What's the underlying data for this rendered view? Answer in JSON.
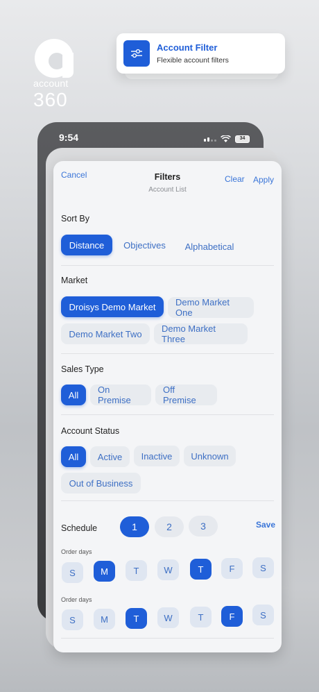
{
  "brand": {
    "word": "account",
    "number": "360"
  },
  "feature_card": {
    "title": "Account Filter",
    "subtitle": "Flexible account filters",
    "icon": "sliders-icon"
  },
  "status_bar": {
    "time": "9:54",
    "battery": "34"
  },
  "header": {
    "cancel": "Cancel",
    "title": "Filters",
    "subtitle": "Account List",
    "clear": "Clear",
    "apply": "Apply"
  },
  "sort_by": {
    "label": "Sort By",
    "options": [
      "Distance",
      "Objectives",
      "Alphabetical"
    ],
    "selected": "Distance"
  },
  "market": {
    "label": "Market",
    "options": [
      "Droisys Demo Market",
      "Demo Market One",
      "Demo Market Two",
      "Demo Market Three"
    ],
    "selected": "Droisys Demo Market"
  },
  "sales_type": {
    "label": "Sales Type",
    "options": [
      "All",
      "On Premise",
      "Off Premise"
    ],
    "selected": "All"
  },
  "account_status": {
    "label": "Account Status",
    "options": [
      "All",
      "Active",
      "Inactive",
      "Unknown",
      "Out of Business"
    ],
    "selected": "All"
  },
  "schedule": {
    "label": "Schedule",
    "pages": [
      "1",
      "2",
      "3"
    ],
    "selected_page": "1",
    "save": "Save",
    "rows": [
      {
        "label": "Order days",
        "days": [
          "S",
          "M",
          "T",
          "W",
          "T",
          "F",
          "S"
        ],
        "selected_index": [
          1,
          4
        ]
      },
      {
        "label": "Order days",
        "days": [
          "S",
          "M",
          "T",
          "W",
          "T",
          "F",
          "S"
        ],
        "selected_index": [
          2,
          5
        ]
      }
    ]
  },
  "colors": {
    "accent": "#1f5ed8",
    "link": "#3a75d8",
    "chip_bg": "#e8ebef"
  }
}
